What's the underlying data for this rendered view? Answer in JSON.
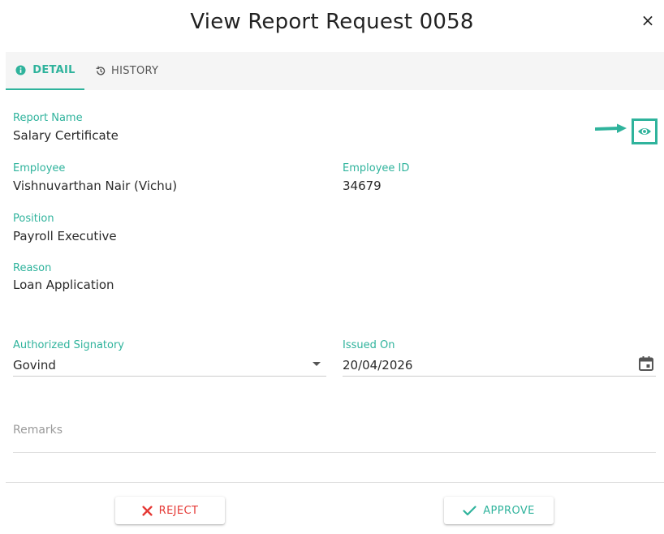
{
  "dialog": {
    "title": "View Report Request 0058",
    "close_symbol": "×"
  },
  "tabs": [
    {
      "label": "DETAIL",
      "icon": "info-icon",
      "active": true
    },
    {
      "label": "HISTORY",
      "icon": "history-icon",
      "active": false
    }
  ],
  "fields": {
    "report_name": {
      "label": "Report Name",
      "value": "Salary Certificate"
    },
    "employee": {
      "label": "Employee",
      "value": "Vishnuvarthan Nair (Vichu)"
    },
    "employee_id": {
      "label": "Employee ID",
      "value": "34679"
    },
    "position": {
      "label": "Position",
      "value": "Payroll Executive"
    },
    "reason": {
      "label": "Reason",
      "value": "Loan Application"
    },
    "authorized_signatory": {
      "label": "Authorized Signatory",
      "value": "Govind"
    },
    "issued_on": {
      "label": "Issued On",
      "value": "20/04/2026"
    },
    "remarks": {
      "placeholder": "Remarks"
    }
  },
  "actions": {
    "reject_label": "REJECT",
    "approve_label": "APPROVE"
  },
  "colors": {
    "accent": "#2fb39c",
    "reject": "#e53935"
  },
  "icons": {
    "view": "eye-icon",
    "pointer": "arrow-right-icon",
    "calendar": "calendar-icon",
    "dropdown": "chevron-down-icon",
    "reject": "close-icon",
    "approve": "check-icon"
  }
}
